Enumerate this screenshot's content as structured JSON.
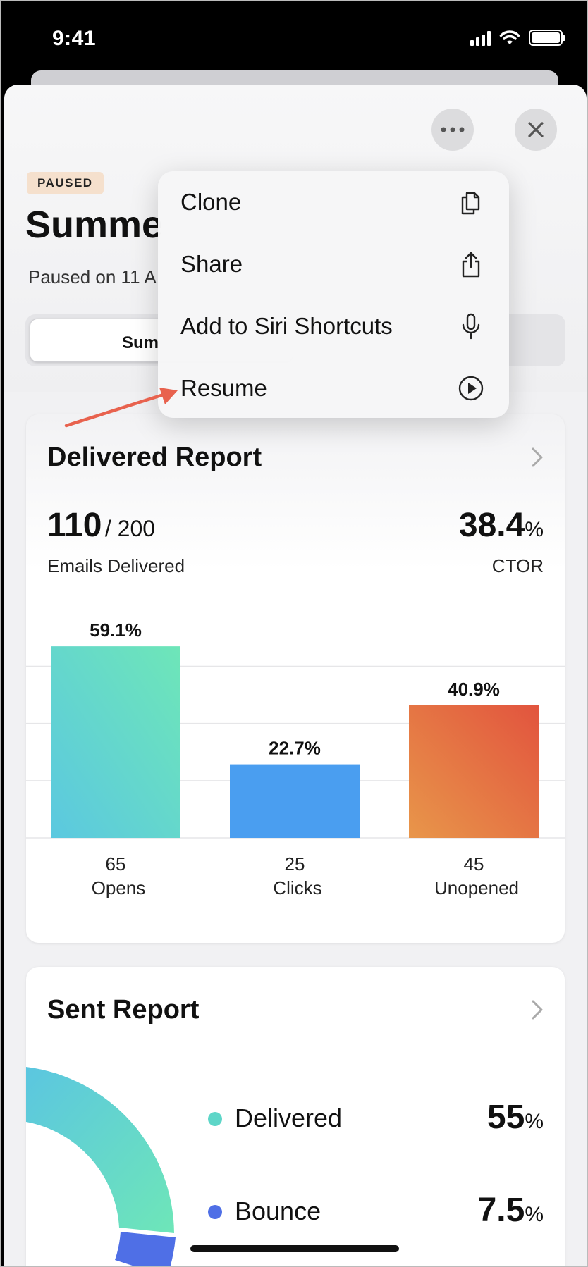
{
  "status_bar": {
    "time": "9:41"
  },
  "header": {
    "more_icon": "ellipsis-icon",
    "close_icon": "close-icon",
    "badge": "PAUSED",
    "title": "Summe",
    "subtitle": "Paused on 11 A",
    "segment_active_label": "Sum"
  },
  "menu": {
    "items": [
      {
        "label": "Clone",
        "icon": "copy-icon"
      },
      {
        "label": "Share",
        "icon": "share-icon"
      },
      {
        "label": "Add to Siri Shortcuts",
        "icon": "microphone-icon"
      },
      {
        "label": "Resume",
        "icon": "play-circle-icon"
      }
    ]
  },
  "delivered_report": {
    "title": "Delivered Report",
    "delivered_count": "110",
    "delivered_total": "/ 200",
    "delivered_label": "Emails Delivered",
    "ctor_value": "38.4",
    "ctor_unit": "%",
    "ctor_label": "CTOR"
  },
  "chart_data": {
    "type": "bar",
    "categories": [
      "Opens",
      "Clicks",
      "Unopened"
    ],
    "counts": [
      "65",
      "25",
      "45"
    ],
    "values": [
      59.1,
      22.7,
      40.9
    ],
    "value_labels": [
      "59.1%",
      "22.7%",
      "40.9%"
    ],
    "ylim": [
      0,
      60
    ],
    "grid": true,
    "colors": [
      [
        "#5bc8e0",
        "#6ee6b8"
      ],
      [
        "#4a9ef0",
        "#4a9ef0"
      ],
      [
        "#e8964a",
        "#e2543e"
      ]
    ]
  },
  "sent_report": {
    "title": "Sent Report",
    "legend": [
      {
        "label": "Delivered",
        "value": "55",
        "unit": "%",
        "color": "#5ed6c8"
      },
      {
        "label": "Bounce",
        "value": "7.5",
        "unit": "%",
        "color": "#4f6fe6"
      }
    ]
  },
  "colors": {
    "annotation_arrow": "#e8624e",
    "badge_bg": "#f5e0cd"
  }
}
